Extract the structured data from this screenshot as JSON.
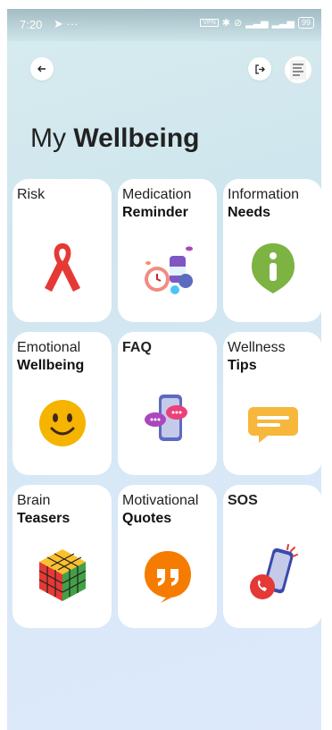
{
  "status": {
    "time": "7:20",
    "battery": "99"
  },
  "header": {
    "title_light": "My",
    "title_bold": "Wellbeing"
  },
  "cards": [
    {
      "line1": "Risk",
      "line2": "",
      "icon": "ribbon-icon"
    },
    {
      "line1": "Medication",
      "line2": "Reminder",
      "icon": "pills-clock-icon"
    },
    {
      "line1": "Information",
      "line2": "Needs",
      "icon": "info-bubble-icon"
    },
    {
      "line1": "Emotional",
      "line2": "Wellbeing",
      "icon": "smiley-icon"
    },
    {
      "line1": "FAQ",
      "line2": "",
      "icon": "phone-chat-icon"
    },
    {
      "line1": "Wellness",
      "line2": "Tips",
      "icon": "message-icon"
    },
    {
      "line1": "Brain",
      "line2": "Teasers",
      "icon": "rubiks-cube-icon"
    },
    {
      "line1": "Motivational",
      "line2": "Quotes",
      "icon": "quote-icon"
    },
    {
      "line1": "SOS",
      "line2": "",
      "icon": "sos-phone-icon"
    }
  ],
  "colors": {
    "ribbon": "#e53935",
    "info": "#7cb342",
    "smiley": "#f5b400",
    "message": "#f6b73c",
    "quote": "#f57c00",
    "sos": "#e53935"
  }
}
